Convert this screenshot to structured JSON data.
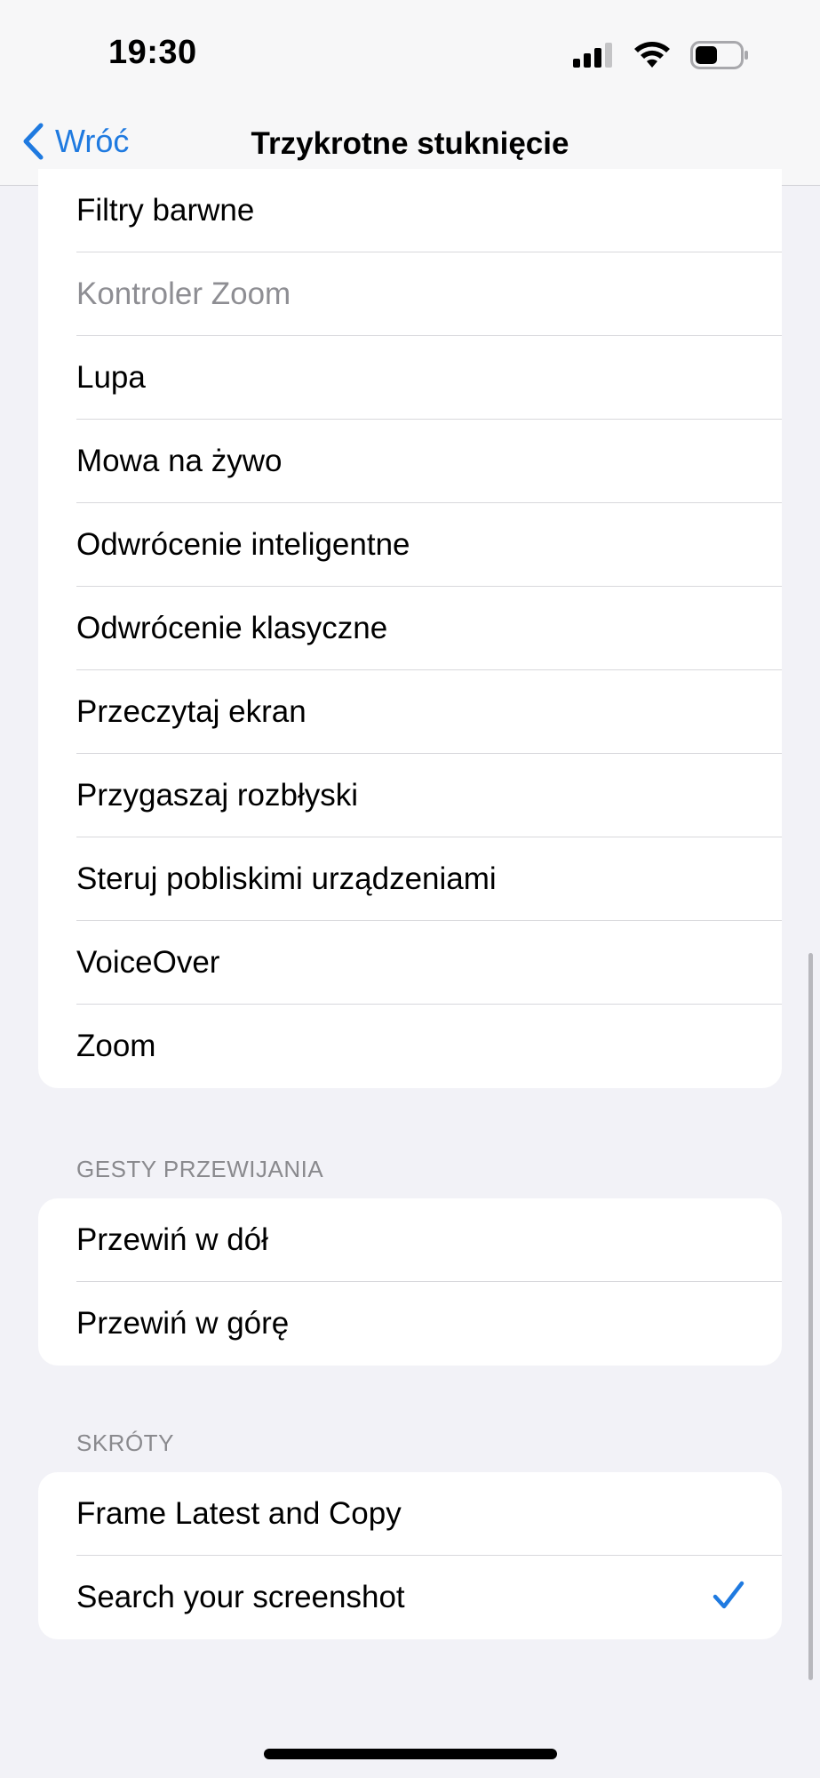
{
  "status_bar": {
    "time": "19:30"
  },
  "nav": {
    "back_label": "Wróć",
    "title": "Trzykrotne stuknięcie"
  },
  "accessibility_items": [
    {
      "label": "Filtry barwne",
      "enabled": true
    },
    {
      "label": "Kontroler Zoom",
      "enabled": false
    },
    {
      "label": "Lupa",
      "enabled": true
    },
    {
      "label": "Mowa na żywo",
      "enabled": true
    },
    {
      "label": "Odwrócenie inteligentne",
      "enabled": true
    },
    {
      "label": "Odwrócenie klasyczne",
      "enabled": true
    },
    {
      "label": "Przeczytaj ekran",
      "enabled": true
    },
    {
      "label": "Przygaszaj rozbłyski",
      "enabled": true
    },
    {
      "label": "Steruj pobliskimi urządzeniami",
      "enabled": true
    },
    {
      "label": "VoiceOver",
      "enabled": true
    },
    {
      "label": "Zoom",
      "enabled": true
    }
  ],
  "scroll_gestures": {
    "header": "GESTY PRZEWIJANIA",
    "items": [
      {
        "label": "Przewiń w dół"
      },
      {
        "label": "Przewiń w górę"
      }
    ]
  },
  "shortcuts": {
    "header": "SKRÓTY",
    "items": [
      {
        "label": "Frame Latest and Copy",
        "checked": false
      },
      {
        "label": "Search your screenshot",
        "checked": true
      }
    ]
  },
  "colors": {
    "accent": "#1f7ae0",
    "background": "#f2f2f7",
    "disabled_text": "#8e8e93"
  }
}
